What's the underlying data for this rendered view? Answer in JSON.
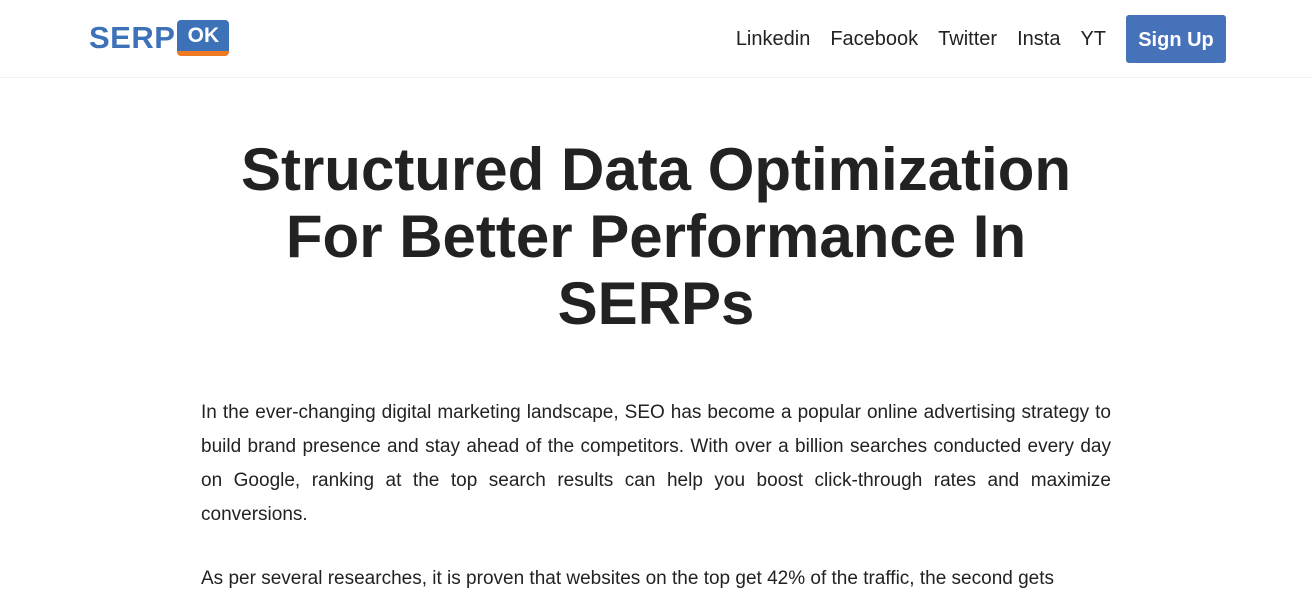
{
  "header": {
    "logo": {
      "text": "SERP",
      "badge": "OK",
      "colors": {
        "blue": "#3d72b8",
        "orange": "#f07a22"
      }
    },
    "nav": [
      {
        "label": "Linkedin"
      },
      {
        "label": "Facebook"
      },
      {
        "label": "Twitter"
      },
      {
        "label": "Insta"
      },
      {
        "label": "YT"
      }
    ],
    "signup_label": "Sign Up",
    "signup_color": "#4672b9"
  },
  "article": {
    "title": "Structured Data Optimization For Better Performance In SERPs",
    "paragraphs": [
      "In the ever-changing digital marketing landscape, SEO has become a popular online advertising strategy to build brand presence and stay ahead of the competitors. With over a billion searches conducted every day on Google, ranking at the top search results can help you boost click-through rates and maximize conversions.",
      "As per several researches, it is proven that websites on the top get 42% of the traffic, the second gets"
    ]
  }
}
